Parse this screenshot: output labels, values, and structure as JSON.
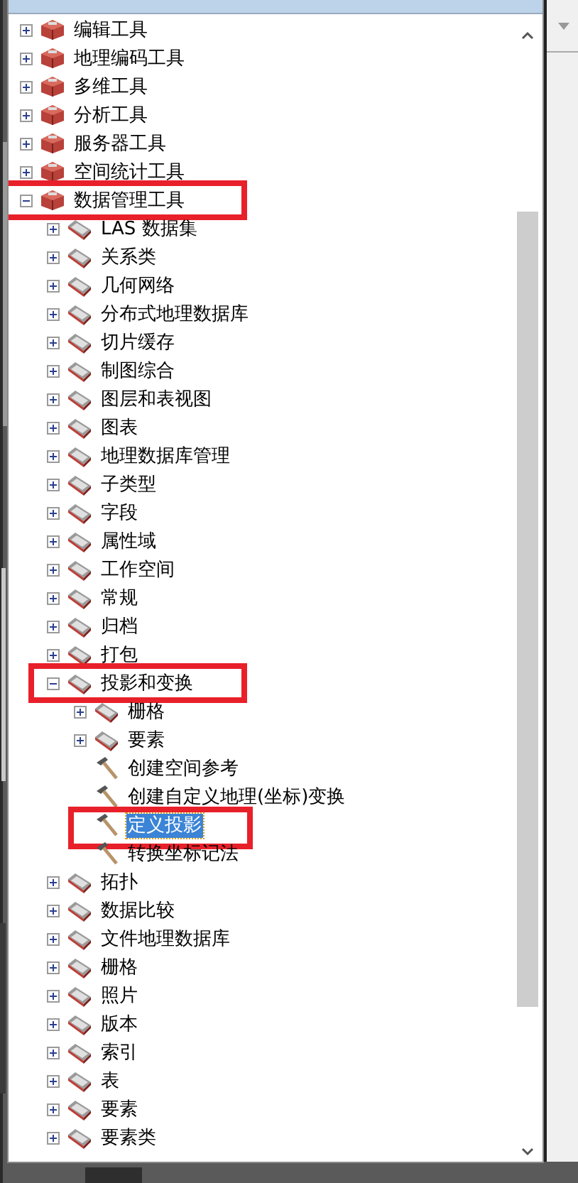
{
  "toolbox": {
    "items": [
      {
        "label": "编辑工具",
        "kind": "toolbox",
        "expanded": false,
        "marked": false,
        "selected": false
      },
      {
        "label": "地理编码工具",
        "kind": "toolbox",
        "expanded": false,
        "marked": false,
        "selected": false
      },
      {
        "label": "多维工具",
        "kind": "toolbox",
        "expanded": false,
        "marked": false,
        "selected": false
      },
      {
        "label": "分析工具",
        "kind": "toolbox",
        "expanded": false,
        "marked": false,
        "selected": false
      },
      {
        "label": "服务器工具",
        "kind": "toolbox",
        "expanded": false,
        "marked": false,
        "selected": false
      },
      {
        "label": "空间统计工具",
        "kind": "toolbox",
        "expanded": false,
        "marked": false,
        "selected": false
      },
      {
        "label": "数据管理工具",
        "kind": "toolbox",
        "expanded": true,
        "marked": true,
        "selected": false,
        "children": [
          {
            "label": "LAS 数据集",
            "kind": "toolset",
            "expanded": false,
            "marked": false,
            "selected": false
          },
          {
            "label": "关系类",
            "kind": "toolset",
            "expanded": false,
            "marked": false,
            "selected": false
          },
          {
            "label": "几何网络",
            "kind": "toolset",
            "expanded": false,
            "marked": false,
            "selected": false
          },
          {
            "label": "分布式地理数据库",
            "kind": "toolset",
            "expanded": false,
            "marked": false,
            "selected": false
          },
          {
            "label": "切片缓存",
            "kind": "toolset",
            "expanded": false,
            "marked": false,
            "selected": false
          },
          {
            "label": "制图综合",
            "kind": "toolset",
            "expanded": false,
            "marked": false,
            "selected": false
          },
          {
            "label": "图层和表视图",
            "kind": "toolset",
            "expanded": false,
            "marked": false,
            "selected": false
          },
          {
            "label": "图表",
            "kind": "toolset",
            "expanded": false,
            "marked": false,
            "selected": false
          },
          {
            "label": "地理数据库管理",
            "kind": "toolset",
            "expanded": false,
            "marked": false,
            "selected": false
          },
          {
            "label": "子类型",
            "kind": "toolset",
            "expanded": false,
            "marked": false,
            "selected": false
          },
          {
            "label": "字段",
            "kind": "toolset",
            "expanded": false,
            "marked": false,
            "selected": false
          },
          {
            "label": "属性域",
            "kind": "toolset",
            "expanded": false,
            "marked": false,
            "selected": false
          },
          {
            "label": "工作空间",
            "kind": "toolset",
            "expanded": false,
            "marked": false,
            "selected": false
          },
          {
            "label": "常规",
            "kind": "toolset",
            "expanded": false,
            "marked": false,
            "selected": false
          },
          {
            "label": "归档",
            "kind": "toolset",
            "expanded": false,
            "marked": false,
            "selected": false
          },
          {
            "label": "打包",
            "kind": "toolset",
            "expanded": false,
            "marked": false,
            "selected": false
          },
          {
            "label": "投影和变换",
            "kind": "toolset",
            "expanded": true,
            "marked": true,
            "selected": false,
            "children": [
              {
                "label": "栅格",
                "kind": "toolset",
                "expanded": false,
                "marked": false,
                "selected": false
              },
              {
                "label": "要素",
                "kind": "toolset",
                "expanded": false,
                "marked": false,
                "selected": false
              },
              {
                "label": "创建空间参考",
                "kind": "tool",
                "marked": false,
                "selected": false
              },
              {
                "label": "创建自定义地理(坐标)变换",
                "kind": "tool",
                "marked": false,
                "selected": false
              },
              {
                "label": "定义投影",
                "kind": "tool",
                "marked": true,
                "selected": true
              },
              {
                "label": "转换坐标记法",
                "kind": "tool",
                "marked": false,
                "selected": false
              }
            ]
          },
          {
            "label": "拓扑",
            "kind": "toolset",
            "expanded": false,
            "marked": false,
            "selected": false
          },
          {
            "label": "数据比较",
            "kind": "toolset",
            "expanded": false,
            "marked": false,
            "selected": false
          },
          {
            "label": "文件地理数据库",
            "kind": "toolset",
            "expanded": false,
            "marked": false,
            "selected": false
          },
          {
            "label": "栅格",
            "kind": "toolset",
            "expanded": false,
            "marked": false,
            "selected": false
          },
          {
            "label": "照片",
            "kind": "toolset",
            "expanded": false,
            "marked": false,
            "selected": false
          },
          {
            "label": "版本",
            "kind": "toolset",
            "expanded": false,
            "marked": false,
            "selected": false
          },
          {
            "label": "索引",
            "kind": "toolset",
            "expanded": false,
            "marked": false,
            "selected": false
          },
          {
            "label": "表",
            "kind": "toolset",
            "expanded": false,
            "marked": false,
            "selected": false
          },
          {
            "label": "要素",
            "kind": "toolset",
            "expanded": false,
            "marked": false,
            "selected": false
          },
          {
            "label": "要素类",
            "kind": "toolset",
            "expanded": false,
            "marked": false,
            "selected": false
          }
        ]
      }
    ]
  }
}
